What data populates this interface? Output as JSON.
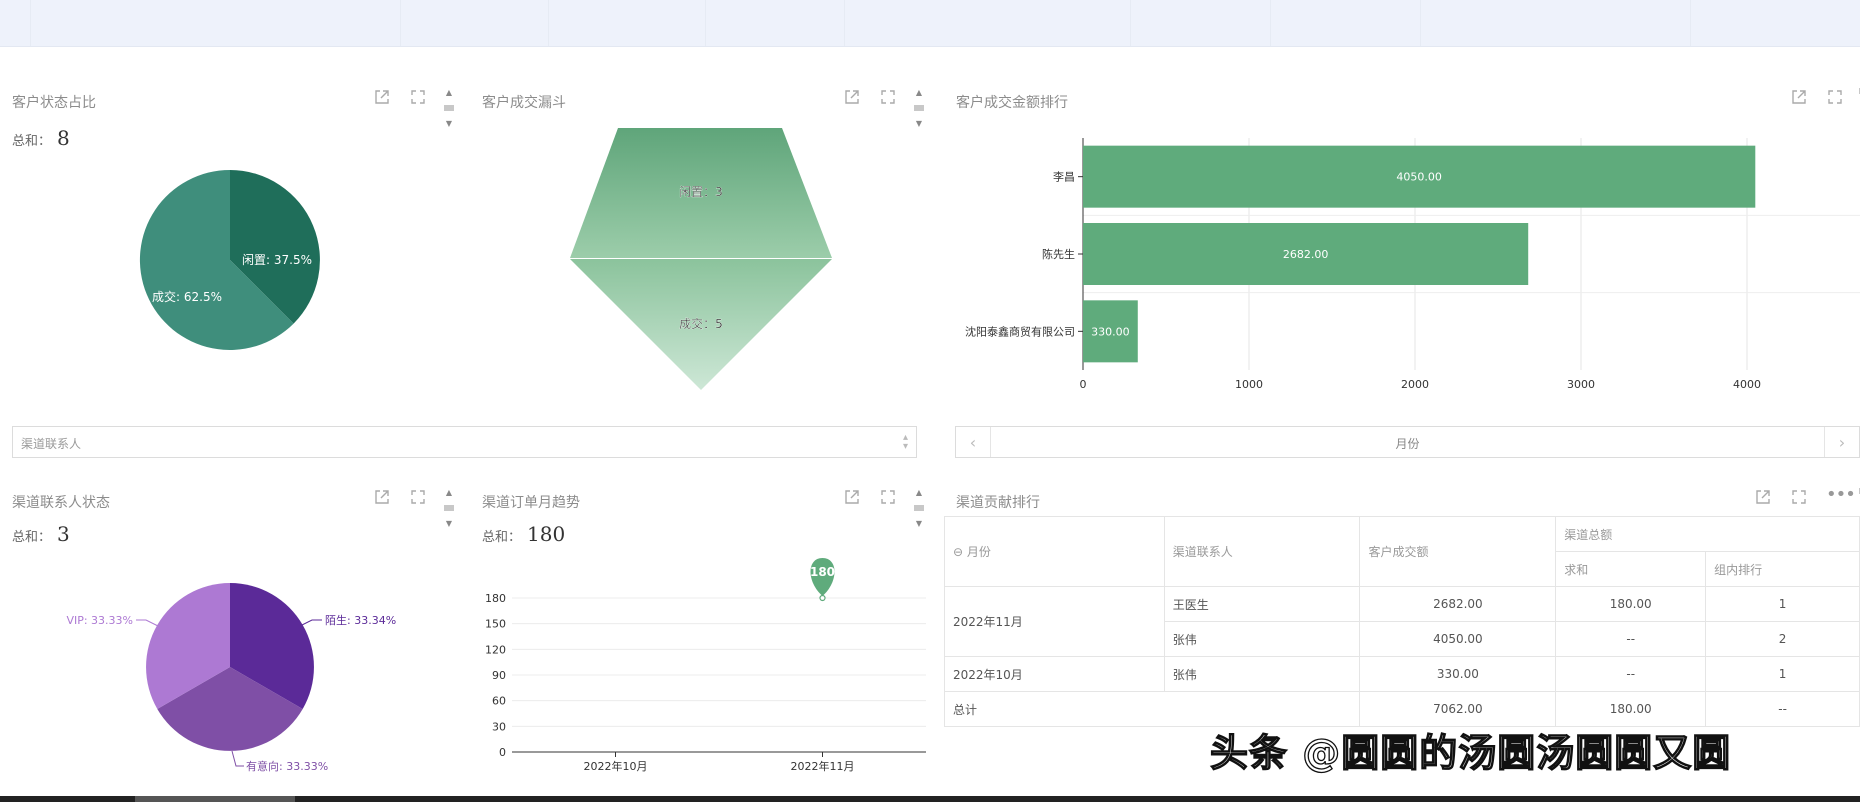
{
  "panels": {
    "status": {
      "title": "客户状态占比",
      "total_label": "总和：",
      "total": "8"
    },
    "funnel": {
      "title": "客户成交漏斗"
    },
    "amount": {
      "title": "客户成交金额排行"
    },
    "channel_status": {
      "title": "渠道联系人状态",
      "total_label": "总和：",
      "total": "3"
    },
    "orders": {
      "title": "渠道订单月趋势",
      "total_label": "总和：",
      "total": "180"
    },
    "contrib": {
      "title": "渠道贡献排行"
    }
  },
  "filters": {
    "contact_placeholder": "渠道联系人",
    "month_label": "月份"
  },
  "icons": {
    "export": "external-link-icon",
    "fullscreen": "fullscreen-icon",
    "more": "more-icon"
  },
  "colors": {
    "green": "#5fab7c",
    "teal_dark": "#1f6e5a",
    "teal_light": "#3f8e7c",
    "purple1": "#5b2a98",
    "purple2": "#7f4fa6",
    "purple3": "#ad79d3"
  },
  "chart_data": [
    {
      "id": "status_pie",
      "type": "pie",
      "slices": [
        {
          "name": "闲置",
          "value": 3,
          "label": "闲置: 37.5%",
          "color": "#1f6e5a"
        },
        {
          "name": "成交",
          "value": 5,
          "label": "成交: 62.5%",
          "color": "#3f8e7c"
        }
      ]
    },
    {
      "id": "funnel",
      "type": "funnel",
      "stages": [
        {
          "name": "闲置",
          "value": 3,
          "label": "闲置：3"
        },
        {
          "name": "成交",
          "value": 5,
          "label": "成交：5"
        }
      ]
    },
    {
      "id": "amount_bar",
      "type": "bar",
      "orientation": "horizontal",
      "categories": [
        "李昌",
        "陈先生",
        "沈阳泰鑫商贸有限公司"
      ],
      "values": [
        4050.0,
        2682.0,
        330.0
      ],
      "value_labels": [
        "4050.00",
        "2682.00",
        "330.00"
      ],
      "xlim": [
        0,
        5000
      ],
      "ticks": [
        "0",
        "1000",
        "2000",
        "3000",
        "4000",
        "5000"
      ],
      "grid": true
    },
    {
      "id": "channel_pie",
      "type": "pie",
      "slices": [
        {
          "name": "陌生",
          "value": 33.34,
          "label": "陌生: 33.34%",
          "color": "#5b2a98"
        },
        {
          "name": "有意向",
          "value": 33.33,
          "label": "有意向: 33.33%",
          "color": "#7f4fa6"
        },
        {
          "name": "VIP",
          "value": 33.33,
          "label": "VIP: 33.33%",
          "color": "#ad79d3"
        }
      ]
    },
    {
      "id": "orders_line",
      "type": "line",
      "categories": [
        "2022年10月",
        "2022年11月"
      ],
      "values": [
        null,
        180
      ],
      "ylim": [
        0,
        180
      ],
      "yticks": [
        "0",
        "30",
        "60",
        "90",
        "120",
        "150",
        "180"
      ],
      "marker_label": "180",
      "grid": true
    }
  ],
  "table": {
    "headers": {
      "month": "月份",
      "contact": "渠道联系人",
      "deal": "客户成交额",
      "group": "渠道总额",
      "sum": "求和",
      "rank": "组内排行"
    },
    "rows": [
      {
        "month": "2022年11月",
        "contact": "王医生",
        "deal": "2682.00",
        "sum": "180.00",
        "rank": "1"
      },
      {
        "month": "",
        "contact": "张伟",
        "deal": "4050.00",
        "sum": "--",
        "rank": "2"
      },
      {
        "month": "2022年10月",
        "contact": "张伟",
        "deal": "330.00",
        "sum": "--",
        "rank": "1"
      }
    ],
    "total": {
      "label": "总计",
      "deal": "7062.00",
      "sum": "180.00",
      "rank": "--"
    }
  },
  "watermark": "头条 @圆圆的汤圆汤圆圆又圆"
}
